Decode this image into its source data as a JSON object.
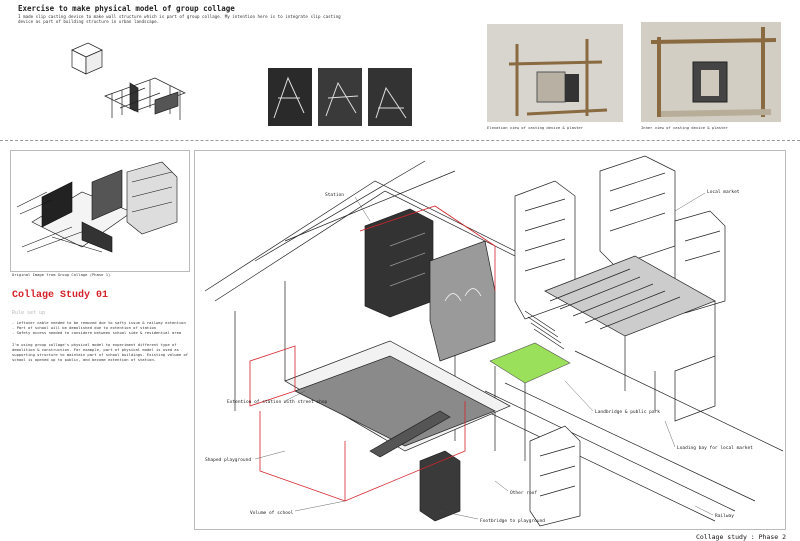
{
  "header": {
    "title": "Exercise to make physical model of group collage",
    "intro": "I made slip casting device to make wall structure which is part of group collage. My intention here is to integrate slip casting device as part of building structure in urban landscape."
  },
  "captions": {
    "elevation": "Elevation view of casting device & plaster",
    "inner": "Inner view of casting device & plaster",
    "original": "Original Image from Group Collage (Phase 1)"
  },
  "study": {
    "title": "Collage Study 01",
    "rule_label": "Rule set up",
    "rules": [
      "- Leftover cable needed to be removed due to safty issue & railway extention",
      "- Part of school will be demolished due to extention of station",
      "- Safety access needed to considere between school side & residential area"
    ],
    "description": "I'm using group collage's physical model to experiment different type of demolition & construction. For example, part of physical model is used as supporting structure to maintain part of school buildings. Existing volume of school is opened up to public, and become extention of station."
  },
  "labels": {
    "station": "Station",
    "local_market": "Local market",
    "extension": "Extention of station with street shop",
    "shaped_playground": "Shaped playground",
    "volume_school": "Volume of school",
    "footbridge": "Footbridge to playground",
    "other_roof": "Other roof",
    "landbridge": "Landbridge & public park",
    "loading_bay": "Loading bay for local market",
    "railway": "Railway"
  },
  "footer": "Collage study : Phase 2",
  "colors": {
    "accent_red": "#d5232a",
    "highlight_green": "#9be05a"
  }
}
